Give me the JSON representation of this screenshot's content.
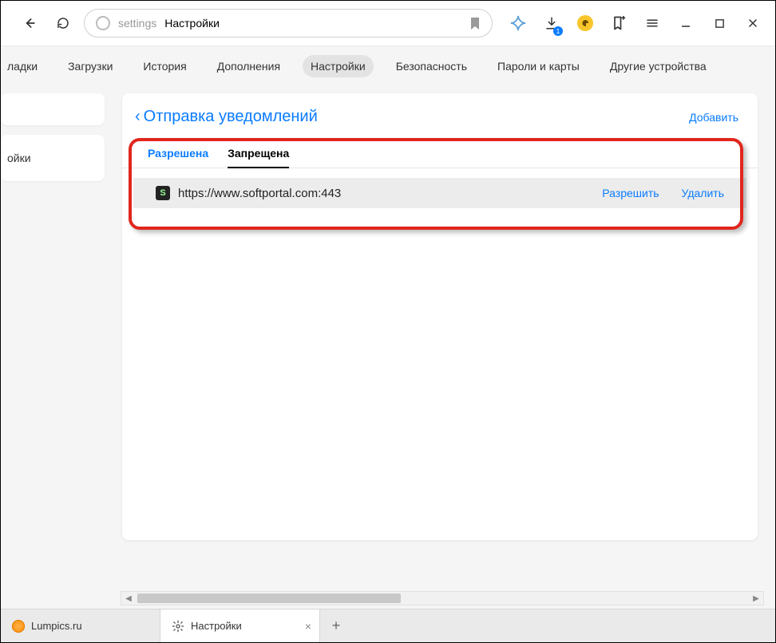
{
  "toolbar": {
    "address_scheme": "settings",
    "address_title": "Настройки",
    "download_badge": "1"
  },
  "nav": {
    "items": [
      "ладки",
      "Загрузки",
      "История",
      "Дополнения",
      "Настройки",
      "Безопасность",
      "Пароли и карты",
      "Другие устройства"
    ],
    "active_index": 4
  },
  "sidebar": {
    "item_fragment": "ойки"
  },
  "panel": {
    "title": "Отправка уведомлений",
    "add_label": "Добавить",
    "tabs": {
      "allowed": "Разрешена",
      "denied": "Запрещена"
    },
    "site": {
      "favicon_letter": "S",
      "url": "https://www.softportal.com:443",
      "allow_action": "Разрешить",
      "delete_action": "Удалить"
    }
  },
  "tabs": {
    "items": [
      {
        "label": "Lumpics.ru"
      },
      {
        "label": "Настройки"
      }
    ]
  }
}
